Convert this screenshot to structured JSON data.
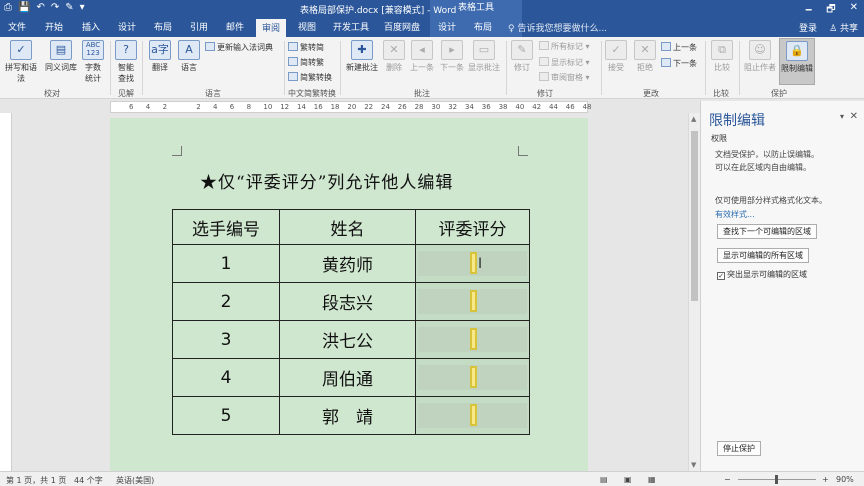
{
  "window": {
    "doc_title": "表格局部保护.docx [兼容模式] - Word",
    "context_tools": "表格工具",
    "qat": [
      "⎙",
      "💾",
      "↶",
      "↷",
      "✎",
      "▾"
    ],
    "controls": [
      "🗕",
      "🗗",
      "✕"
    ]
  },
  "tabs": [
    "文件",
    "开始",
    "插入",
    "设计",
    "布局",
    "引用",
    "邮件",
    "审阅",
    "视图",
    "开发工具",
    "百度网盘",
    "设计",
    "布局"
  ],
  "active_tab_index": 7,
  "tell_me": "♀ 告诉我您想要做什么...",
  "account": {
    "login": "登录",
    "share": "♙ 共享"
  },
  "ribbon": {
    "proofing": {
      "spell": "拼写和语法",
      "thesaurus": "同义词库",
      "wordcount_line1": "字数",
      "wordcount_line2": "统计",
      "wordcount_icon": "ABC\n123",
      "label": "校对"
    },
    "insights": {
      "smart_line1": "智能",
      "smart_line2": "查找",
      "label": "见解"
    },
    "language": {
      "translate": "翻译",
      "language": "语言",
      "update_ime": "更新输入法词典",
      "label": "语言"
    },
    "chinese": {
      "to_trad": "繁转简",
      "to_simp": "简转繁",
      "convert": "简繁转换",
      "label": "中文简繁转换"
    },
    "comments": {
      "new": "新建批注",
      "delete": "删除",
      "prev": "上一条",
      "next": "下一条",
      "show": "显示批注",
      "label": "批注"
    },
    "tracking": {
      "track": "修订",
      "all_markup": "所有标记",
      "show_markup": "显示标记",
      "review_pane": "审阅窗格",
      "label": "修订"
    },
    "changes": {
      "accept": "接受",
      "reject": "拒绝",
      "prev": "上一条",
      "next": "下一条",
      "label": "更改"
    },
    "compare": {
      "compare": "比较",
      "label": "比较"
    },
    "protect": {
      "block_authors": "阻止作者",
      "restrict": "限制编辑",
      "label": "保护"
    }
  },
  "ruler_numbers": [
    "6",
    "4",
    "2",
    "",
    "2",
    "4",
    "6",
    "8",
    "10",
    "12",
    "14",
    "16",
    "18",
    "20",
    "22",
    "24",
    "26",
    "28",
    "30",
    "32",
    "34",
    "36",
    "38",
    "40",
    "42",
    "44",
    "46",
    "48"
  ],
  "document": {
    "heading": "★仅“评委评分”列允许他人编辑",
    "table": {
      "headers": [
        "选手编号",
        "姓名",
        "评委评分"
      ],
      "rows": [
        {
          "no": "1",
          "name": "黄药师"
        },
        {
          "no": "2",
          "name": "段志兴"
        },
        {
          "no": "3",
          "name": "洪七公"
        },
        {
          "no": "4",
          "name": "周伯通"
        },
        {
          "no": "5",
          "name": "郭　靖"
        }
      ]
    }
  },
  "pane": {
    "title": "限制编辑",
    "section": "权限",
    "desc1": "文档受保护，以防止误编辑。",
    "desc2": "可以在此区域内自由编辑。",
    "desc3": "仅可使用部分样式格式化文本。",
    "link": "有效样式...",
    "btn_next": "查找下一个可编辑的区域",
    "btn_all": "显示可编辑的所有区域",
    "chk_highlight": "突出显示可编辑的区域",
    "btn_stop": "停止保护"
  },
  "status": {
    "page": "第 1 页，共 1 页",
    "words": "44 个字",
    "lang": "英语(美国)",
    "zoom": "90%"
  }
}
